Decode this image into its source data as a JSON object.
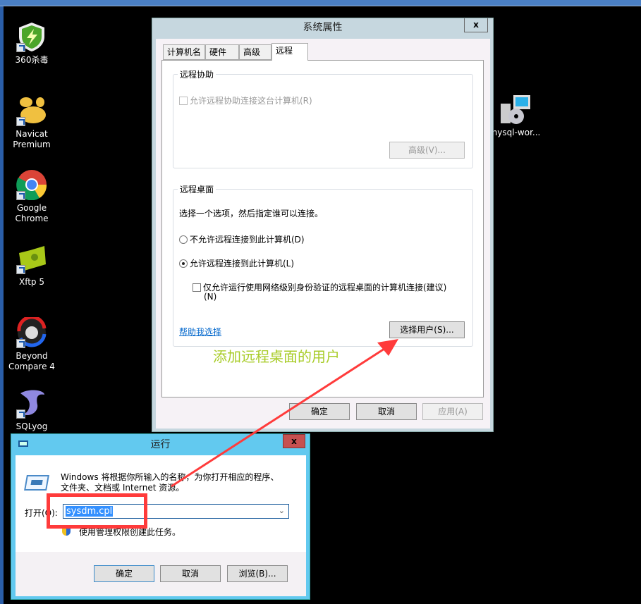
{
  "desktop": {
    "icons": [
      {
        "label_line1": "360杀毒",
        "label_line2": "",
        "icon": "shield-icon"
      },
      {
        "label_line1": "Navicat",
        "label_line2": "Premium",
        "icon": "navicat-icon"
      },
      {
        "label_line1": "Google",
        "label_line2": "Chrome",
        "icon": "chrome-icon"
      },
      {
        "label_line1": "Xftp 5",
        "label_line2": "",
        "icon": "folder-icon"
      },
      {
        "label_line1": "Beyond",
        "label_line2": "Compare 4",
        "icon": "beyond-compare-icon"
      },
      {
        "label_line1": "SQLyog",
        "label_line2": "",
        "icon": "dolphin-icon"
      },
      {
        "label_line1": "mysql-wor...",
        "label_line2": "",
        "icon": "installer-icon"
      }
    ]
  },
  "sysprops": {
    "title": "系统属性",
    "close": "x",
    "tabs": [
      "计算机名",
      "硬件",
      "高级",
      "远程"
    ],
    "active_tab": "远程",
    "remote_assistance": {
      "group_label": "远程协助",
      "checkbox_label": "允许远程协助连接这台计算机(R)",
      "checked": false,
      "advanced_button": "高级(V)..."
    },
    "remote_desktop": {
      "group_label": "远程桌面",
      "instruction": "选择一个选项，然后指定谁可以连接。",
      "option_deny": "不允许远程连接到此计算机(D)",
      "option_allow": "允许远程连接到此计算机(L)",
      "selected": "allow",
      "nla_line1": "仅允许运行使用网络级别身份验证的远程桌面的计算机连接(建议)",
      "nla_line2": "(N)",
      "nla_checked": false,
      "help_link": "帮助我选择",
      "select_users_button": "选择用户(S)..."
    },
    "ok": "确定",
    "cancel": "取消",
    "apply": "应用(A)"
  },
  "annotation": {
    "text": "添加远程桌面的用户",
    "color": "#a8cc28",
    "arrow_color": "#ff3b3b"
  },
  "run": {
    "title": "运行",
    "close": "x",
    "description_line1": "Windows 将根据你所输入的名称，为你打开相应的程序、",
    "description_line2": "文件夹、文档或 Internet 资源。",
    "open_label": "打开(O):",
    "input_value": "sysdm.cpl",
    "admin_note": "使用管理权限创建此任务。",
    "ok": "确定",
    "cancel": "取消",
    "browse": "浏览(B)..."
  }
}
